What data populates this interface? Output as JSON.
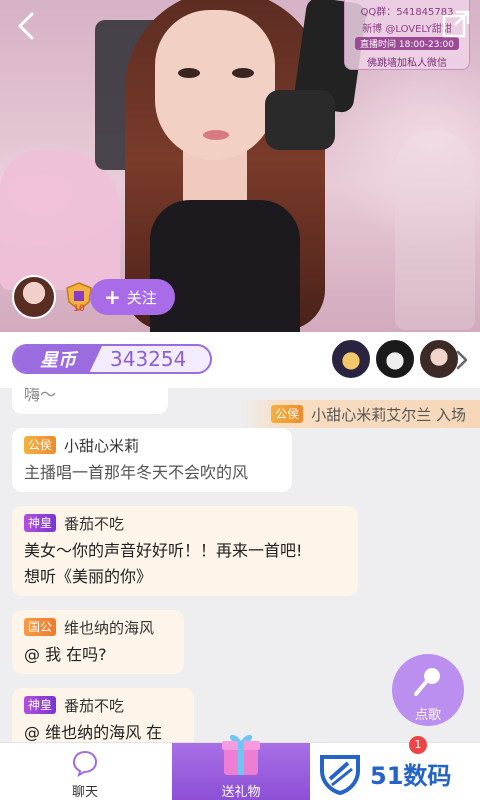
{
  "video": {
    "watermark": {
      "qq": "QQ群：541845783",
      "weibo": "新博 @LOVELY甜甜",
      "schedule": "直播时间 18:00-23:00",
      "wechat": "佛跳墙加私人微信"
    }
  },
  "host": {
    "follow_label": "关注",
    "rank_level": "10"
  },
  "coin": {
    "label": "星币",
    "value": "343254"
  },
  "enter_notice": {
    "tag": "公侯",
    "text": "小甜心米莉艾尔兰 入场"
  },
  "messages": [
    {
      "tag": "",
      "name": "",
      "body": [
        "嗨～"
      ]
    },
    {
      "tag": "公侯",
      "name": "小甜心米莉",
      "body": [
        "主播唱一首那年冬天不会吹的风"
      ]
    },
    {
      "tag": "神皇",
      "name": "番茄不吃",
      "body": [
        "美女～你的声音好好听！！再来一首吧!",
        "想听《美丽的你》"
      ]
    },
    {
      "tag": "国公",
      "name": "维也纳的海风",
      "body": [
        "@ 我 在吗?"
      ]
    },
    {
      "tag": "神皇",
      "name": "番茄不吃",
      "body": [
        "@ 维也纳的海风  在"
      ]
    }
  ],
  "song_button": {
    "label": "点歌"
  },
  "bottom": {
    "chat_label": "聊天",
    "gift_label": "送礼物",
    "notification_count": "1",
    "site_brand": "51数码"
  },
  "colors": {
    "accent": "#a86ce8",
    "coin": "#9b6be0",
    "brand": "#2463c7"
  }
}
